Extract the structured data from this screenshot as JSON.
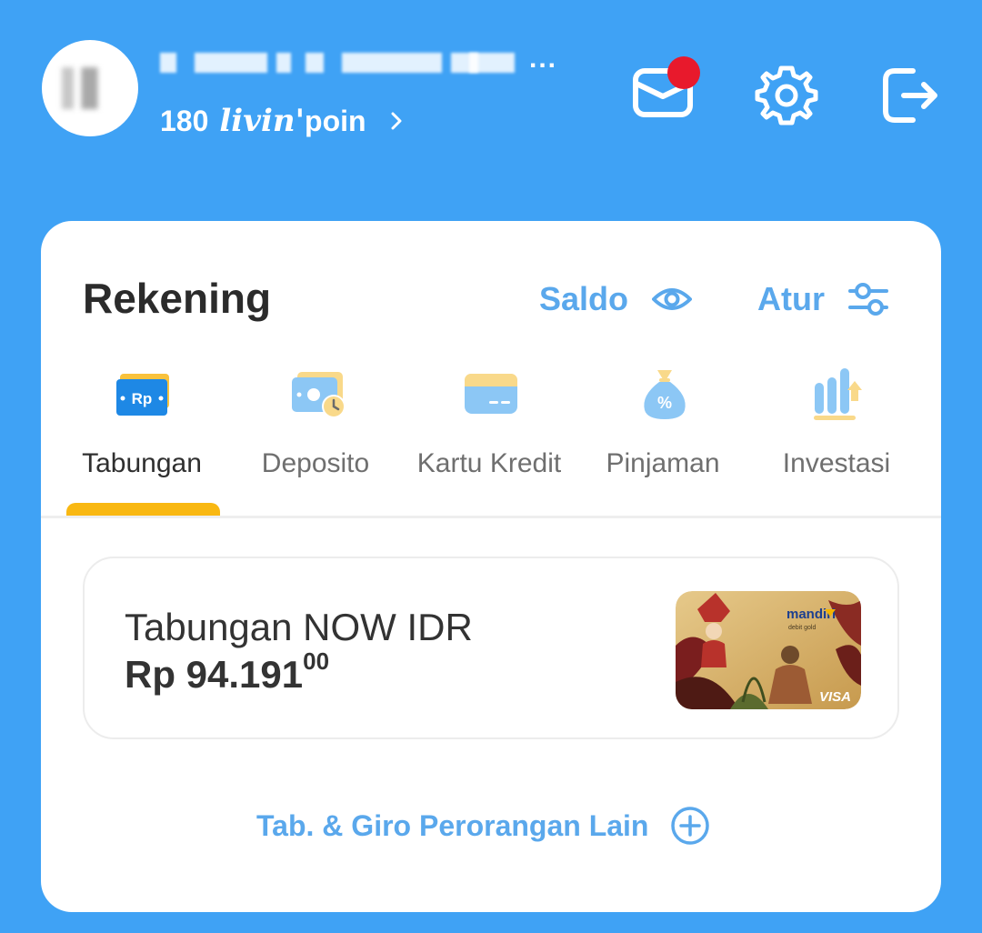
{
  "header": {
    "username_more": "...",
    "poin_value": "180",
    "poin_brand": "livin'",
    "poin_suffix": "poin",
    "notification_dot_color": "#E8192C"
  },
  "rekening": {
    "title": "Rekening",
    "saldo_label": "Saldo",
    "atur_label": "Atur",
    "tabs": [
      {
        "label": "Tabungan",
        "icon": "savings-rp-icon",
        "active": true
      },
      {
        "label": "Deposito",
        "icon": "deposit-icon",
        "active": false
      },
      {
        "label": "Kartu Kredit",
        "icon": "credit-card-icon",
        "active": false
      },
      {
        "label": "Pinjaman",
        "icon": "loan-bag-icon",
        "active": false
      },
      {
        "label": "Investasi",
        "icon": "investment-chart-icon",
        "active": false
      }
    ],
    "account": {
      "name": "Tabungan NOW IDR",
      "balance": "Rp 94.191",
      "balance_decimal": "00",
      "card_brand": "mandiri",
      "card_type": "debit gold",
      "card_network": "VISA"
    },
    "other_accounts_label": "Tab. & Giro Perorangan Lain"
  },
  "colors": {
    "background": "#3FA2F5",
    "accent": "#5AA8EC",
    "tab_indicator": "#F9B812"
  }
}
